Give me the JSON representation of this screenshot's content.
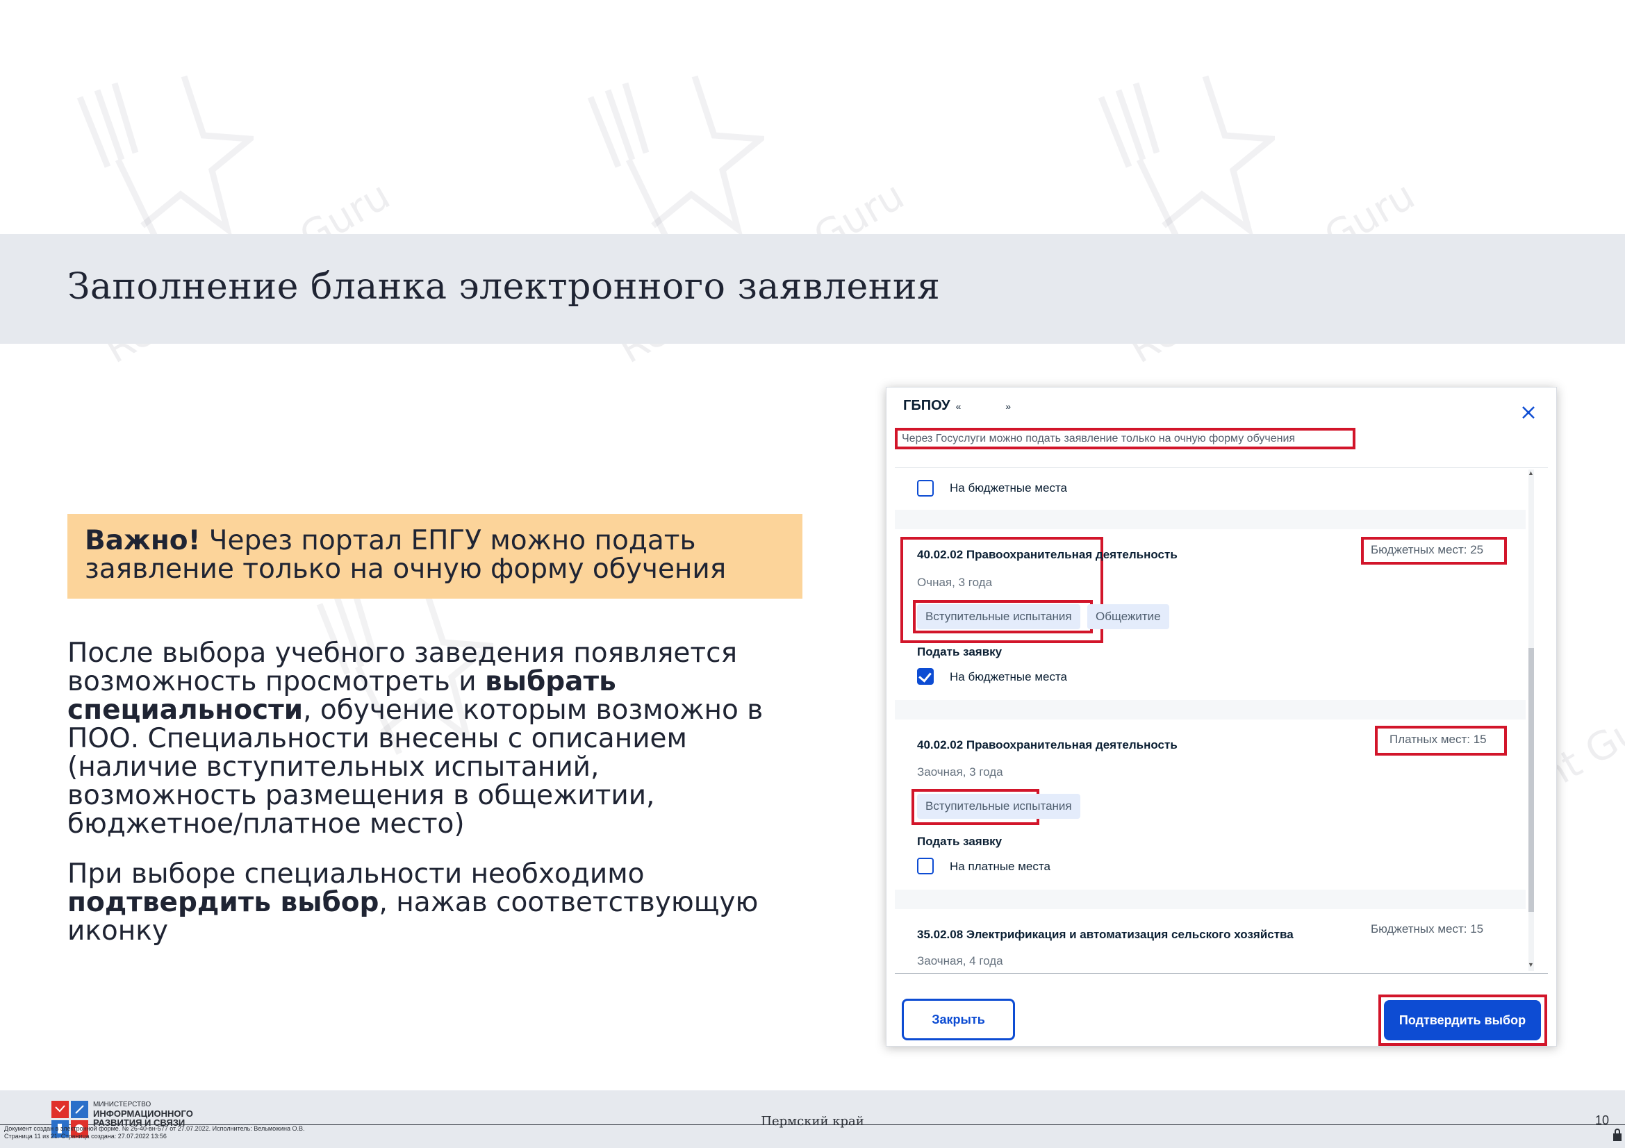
{
  "slide": {
    "title": "Заполнение бланка электронного заявления",
    "important": {
      "bold": "Важно!",
      "text": " Через портал ЕПГУ можно подать заявление только на очную форму обучения"
    },
    "paragraph1": {
      "part1": "После выбора учебного заведения появляется возможность просмотреть и ",
      "bold": "выбрать специальности",
      "part2": ", обучение которым возможно в ПОО. Специальности внесены с описанием (наличие вступительных испытаний, возможность размещения в общежитии, бюджетное/платное место)"
    },
    "paragraph2": {
      "part1": "При выборе специальности необходимо ",
      "bold": "подтвердить выбор",
      "part2": ", нажав соответствующую иконку"
    }
  },
  "dialog": {
    "title": "ГБПОУ",
    "title_tail": "« »",
    "notice": "Через Госуслуги можно подать заявление только на очную форму обучения",
    "top_checkbox_label": "На бюджетные места",
    "specialties": [
      {
        "name": "40.02.02 Правоохранительная деятельность",
        "form": "Очная, 3 года",
        "places": "Бюджетных мест: 25",
        "tags": [
          "Вступительные испытания",
          "Общежитие"
        ],
        "apply_label": "Подать заявку",
        "checkbox_label": "На бюджетные места",
        "checked": true
      },
      {
        "name": "40.02.02 Правоохранительная деятельность",
        "form": "Заочная, 3 года",
        "places": "Платных мест: 15",
        "tags": [
          "Вступительные испытания"
        ],
        "apply_label": "Подать заявку",
        "checkbox_label": "На платные места",
        "checked": false
      },
      {
        "name": "35.02.08 Электрификация и автоматизация сельского хозяйства",
        "form": "Заочная, 4 года",
        "places": "Бюджетных мест: 15"
      }
    ],
    "close_button": "Закрыть",
    "confirm_button": "Подтвердить выбор"
  },
  "footer": {
    "ministry_line1": "МИНИСТЕРСТВО",
    "ministry_line2": "ИНФОРМАЦИОННОГО",
    "ministry_line3": "РАЗВИТИЯ И СВЯЗИ",
    "region": "Пермский край",
    "page_number": "10",
    "doc_meta_line1": "Документ создан в электронной форме. № 26-40-вн-577 от 27.07.2022. Исполнитель: Вельможина О.В.",
    "doc_meta_line2": "Страница 11 из 21. Страница создана: 27.07.2022 13:56"
  },
  "watermark": "Restaurant Guru",
  "colors": {
    "highlight_red": "#d2152a",
    "accent_blue": "#0d4cd3",
    "important_bg": "#fcd49a",
    "band_bg": "#e6e9ee"
  }
}
